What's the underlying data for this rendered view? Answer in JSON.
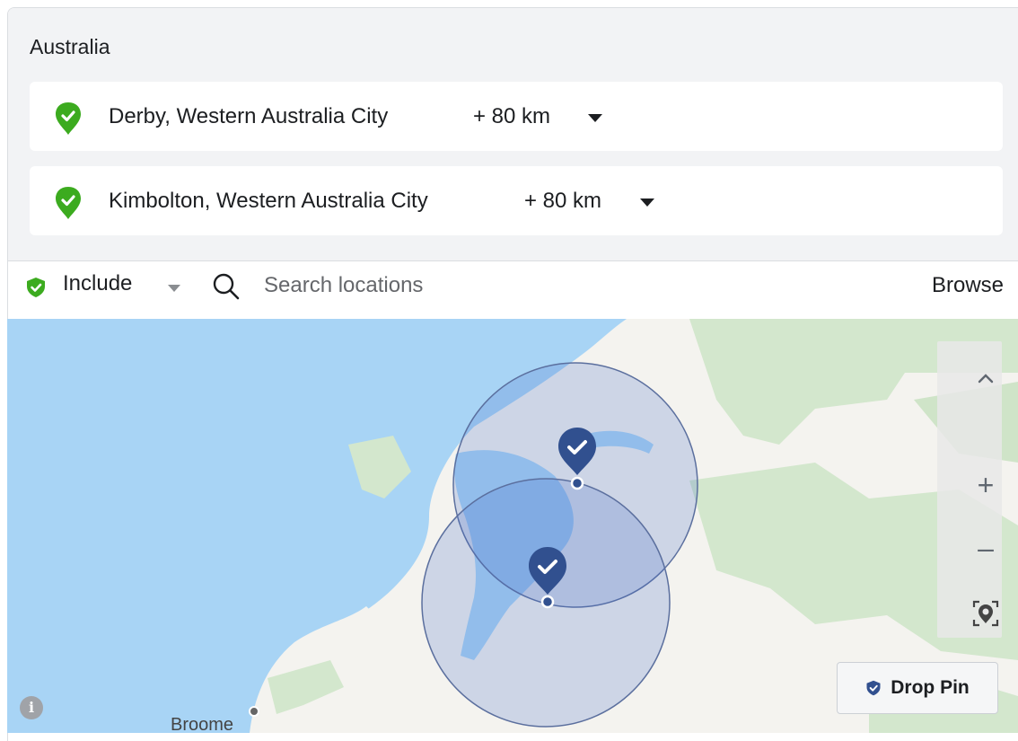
{
  "country": "Australia",
  "locations": [
    {
      "name": "Derby, Western Australia City",
      "radius": "+ 80 km"
    },
    {
      "name": "Kimbolton, Western Australia City",
      "radius": "+ 80 km"
    }
  ],
  "search": {
    "mode": "Include",
    "placeholder": "Search locations",
    "browse": "Browse"
  },
  "map": {
    "controls": {
      "up": "^",
      "zoom_in": "+",
      "zoom_out": "–"
    },
    "drop_pin": "Drop Pin",
    "info": "i",
    "city_label": "Broome"
  },
  "colors": {
    "include_green": "#3cab1f",
    "pin_blue": "#31508f",
    "water": "#a8d4f5",
    "land": "#f4f3ef",
    "vegetation": "#d3e7cd",
    "radius_fill": "rgba(68,110,200,0.22)"
  }
}
